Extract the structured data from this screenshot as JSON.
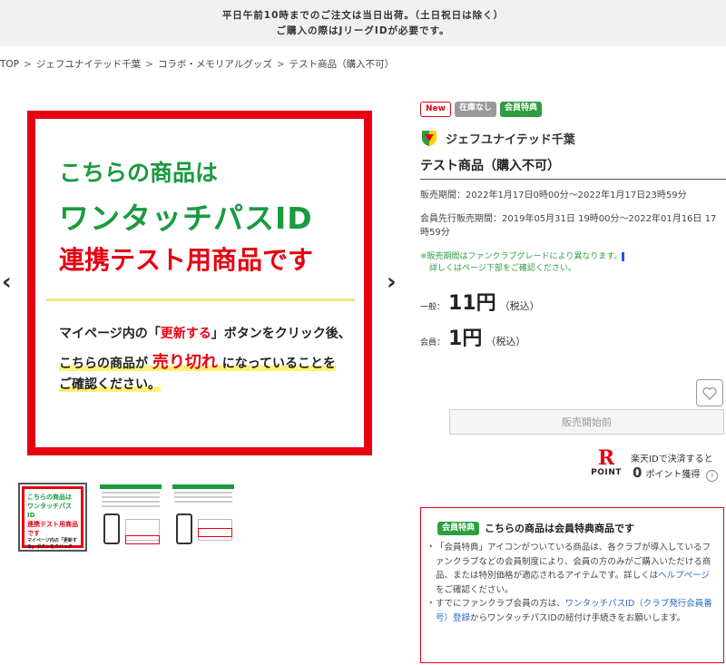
{
  "notice": {
    "line1": "平日午前10時までのご注文は当日出荷。（土日祝日は除く）",
    "line2": "ご購入の際はJリーグIDが必要です。"
  },
  "breadcrumb": [
    "TOP",
    "ジェフユナイテッド千葉",
    "コラボ・メモリアルグッズ",
    "テスト商品（購入不可）"
  ],
  "breadcrumb_sep": ">",
  "main_image": {
    "line1": "こちらの商品は",
    "line2": "ワンタッチパスID",
    "line3": "連携テスト用商品です",
    "text1_a": "マイページ内の「",
    "text1_b": "更新する",
    "text1_c": "」ボタンをクリック後、",
    "text2_a": "こちらの商品が",
    "text2_b": "売り切れ",
    "text2_c": "になっていることを",
    "text3": "ご確認ください。",
    "prev": "‹",
    "next": "›"
  },
  "thumb1": {
    "l1": "こちらの商品は",
    "l2": "ワンタッチパスID",
    "l3": "連携テスト用商品です",
    "l4": "マイページ内の「更新する」ボタンをクリック後、こちらの商品が売り切れになっていることをご確認ください。"
  },
  "badges": {
    "new": "New",
    "stock": "在庫なし",
    "member": "会員特典"
  },
  "brand": {
    "name": "ジェフユナイテッド千葉"
  },
  "product": {
    "title": "テスト商品（購入不可）",
    "sale_period": "販売期間：2022年1月17日0時00分～2022年1月17日23時59分",
    "member_period": "会員先行販売期間：2019年05月31日 19時00分～2022年01月16日 17時59分",
    "note1": "※販売期間はファンクラブグレードにより異なります。",
    "note2": "詳しくはページ下部をご確認ください。",
    "price_general_label": "一般：",
    "price_general": "11円",
    "price_member_label": "会員：",
    "price_member": "1円",
    "tax": "（税込）"
  },
  "actions": {
    "favorite_icon": "heart-icon",
    "sale_button": "販売開始前"
  },
  "rakuten": {
    "logo_r": "R",
    "logo_point": "POINT",
    "text1": "楽天IDで決済すると",
    "points": "0",
    "text2": "ポイント獲得",
    "info": "i"
  },
  "member_box": {
    "badge": "会員特典",
    "title": "こちらの商品は会員特典商品です",
    "item1_a": "「会員特典」アイコンがついている商品は、各クラブが導入しているファンクラブなどの会員制度により、会員の方のみがご購入いただける商品、または特別価格が適応されるアイテムです。詳しくは",
    "item1_link": "ヘルプページ",
    "item1_b": "をご確認ください。",
    "item2_a": "すでにファンクラブ会員の方は、",
    "item2_link": "ワンタッチパスID（クラブ発行会員番号）登録",
    "item2_b": "からワンタッチパスIDの紐付け手続きをお願いします。"
  },
  "colors": {
    "accent_red": "#e60012",
    "accent_green": "#2e9e3e",
    "link": "#2b6cc4"
  }
}
